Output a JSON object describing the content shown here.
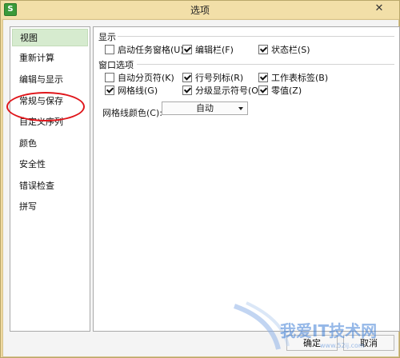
{
  "window": {
    "title": "选项",
    "close_glyph": "✕",
    "app_icon_letter": "S"
  },
  "nav": {
    "items": [
      {
        "label": "视图",
        "selected": true
      },
      {
        "label": "重新计算",
        "selected": false
      },
      {
        "label": "编辑与显示",
        "selected": false
      },
      {
        "label": "常规与保存",
        "selected": false
      },
      {
        "label": "自定义序列",
        "selected": false
      },
      {
        "label": "颜色",
        "selected": false
      },
      {
        "label": "安全性",
        "selected": false
      },
      {
        "label": "错误检查",
        "selected": false
      },
      {
        "label": "拼写",
        "selected": false
      }
    ],
    "highlight_color": "#e0161b"
  },
  "display": {
    "group_label": "显示",
    "options": [
      {
        "label": "启动任务窗格(U)",
        "checked": false
      },
      {
        "label": "编辑栏(F)",
        "checked": true
      },
      {
        "label": "状态栏(S)",
        "checked": true
      }
    ]
  },
  "window_options": {
    "group_label": "窗口选项",
    "options": [
      {
        "label": "自动分页符(K)",
        "checked": false
      },
      {
        "label": "行号列标(R)",
        "checked": true
      },
      {
        "label": "工作表标签(B)",
        "checked": true
      },
      {
        "label": "网格线(G)",
        "checked": true
      },
      {
        "label": "分级显示符号(O)",
        "checked": true
      },
      {
        "label": "零值(Z)",
        "checked": true
      }
    ],
    "grid_color_label": "网格线颜色(C):",
    "grid_color_value": "自动"
  },
  "buttons": {
    "ok": "确定",
    "cancel": "取消"
  },
  "watermark": {
    "text": "我爱IT技术网",
    "subtext": "www.52ij.com"
  }
}
